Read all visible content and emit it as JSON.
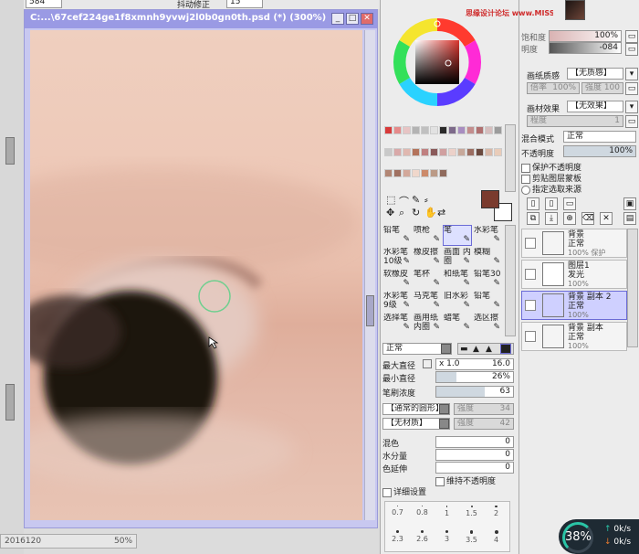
{
  "window": {
    "title": "C:...\\67cef224ge1f8xmnh9yvwj2l0b0gn0th.psd (*) (300%)",
    "min": "_",
    "max": "□",
    "close": "✕"
  },
  "top_strip": {
    "left_field": "584",
    "stab_label": "抖动修正",
    "stab_value": "15"
  },
  "status": {
    "text": "2016120",
    "zoom": "50%"
  },
  "color": {
    "slider1_label": "饱和度",
    "slider1_value": "100%",
    "slider2_label": "明度",
    "slider2_value": "-084"
  },
  "swatches": [
    "#d83a3a",
    "#e58b8b",
    "#e7c4c4",
    "#b3b3b3",
    "#c0c0c0",
    "#e2e2e2",
    "#2a2a2a",
    "#7d6a8a",
    "#a88dc0",
    "#c38d8d",
    "#b07070",
    "#d6bebe",
    "#9c9c9c",
    "#c9c9c9",
    "#d9a9a9",
    "#e0b8b0",
    "#b4745c",
    "#c08080",
    "#8a5a5a",
    "#d0a0a0",
    "#ecd1c9",
    "#c7a89a",
    "#9b6d61",
    "#6b4a3f",
    "#d9b8a8",
    "#e9ccb9",
    "#b28674",
    "#a07060",
    "#d3a89a",
    "#f0d7cb",
    "#cc8a6a",
    "#bb9a86",
    "#8f6a5c"
  ],
  "tools": {
    "rows": [
      [
        {
          "label": "铅笔"
        },
        {
          "label": "喷枪"
        },
        {
          "label": "笔",
          "sel": true
        },
        {
          "label": "水彩笔"
        }
      ],
      [
        {
          "label": "水彩笔 10级"
        },
        {
          "label": "橡皮擦"
        },
        {
          "label": "画面 内圈"
        },
        {
          "label": "模糊"
        }
      ],
      [
        {
          "label": "软橡皮"
        },
        {
          "label": "笔杯"
        },
        {
          "label": "和纸笔"
        },
        {
          "label": "铅笔30"
        }
      ],
      [
        {
          "label": "水彩笔 9级"
        },
        {
          "label": "马克笔"
        },
        {
          "label": "旧水彩"
        },
        {
          "label": "铅笔"
        }
      ],
      [
        {
          "label": "选择笔"
        },
        {
          "label": "画用纸 内圈"
        },
        {
          "label": "蜡笔"
        },
        {
          "label": "选区擦"
        }
      ]
    ]
  },
  "brush": {
    "mode": "正常",
    "max_size_label": "最大直径",
    "max_size_mult": "x 1.0",
    "max_size_value": "16.0",
    "min_size_label": "最小直径",
    "min_size_value": "26%",
    "density_label": "笔刷浓度",
    "density_value": "63",
    "shape": "【通常的圆形】",
    "shape_strength_label": "强度",
    "shape_strength": "34",
    "texture": "【无材质】",
    "texture_strength_label": "强度",
    "texture_strength": "42",
    "mix_label": "混色",
    "mix_value": "0",
    "water_label": "水分量",
    "water_value": "0",
    "extend_label": "色延伸",
    "extend_value": "0",
    "keep_opacity": "维持不透明度",
    "detail": "详细设置"
  },
  "size_grid": [
    "0.7",
    "0.8",
    "1",
    "1.5",
    "2",
    "2.3",
    "2.6",
    "3",
    "3.5",
    "4"
  ],
  "layers_panel": {
    "paper_texture_label": "画纸质感",
    "paper_texture": "【无质感】",
    "scale_label": "倍率",
    "scale_value": "100%",
    "strength_label": "强度",
    "strength_value": "100",
    "material_label": "画材效果",
    "material": "【无效果】",
    "degree_label": "程度",
    "degree_value": "1",
    "blend_label": "混合模式",
    "blend_value": "正常",
    "opacity_label": "不透明度",
    "opacity_value": "100%",
    "protect_alpha": "保护不透明度",
    "clip": "剪贴图层蒙板",
    "select_source": "指定选取来源",
    "layers": [
      {
        "name": "背景",
        "mode": "正常",
        "opacity": "100% 保护"
      },
      {
        "name": "图层1",
        "mode": "发光",
        "opacity": "100%"
      },
      {
        "name": "背景 副本 2",
        "mode": "正常",
        "opacity": "100%",
        "sel": true
      },
      {
        "name": "背景 副本",
        "mode": "正常",
        "opacity": "100%"
      }
    ]
  },
  "watermark": "思缘设计论坛 www.MISSYUAN.COM",
  "progress": {
    "percent": "38%",
    "upload": "0k/s",
    "download": "0k/s"
  },
  "colors": {
    "accent": "#6b6bd6",
    "title_bar": "#9a9ae4",
    "fg_color": "#7a3b2e",
    "bg_color": "#ffffff"
  }
}
